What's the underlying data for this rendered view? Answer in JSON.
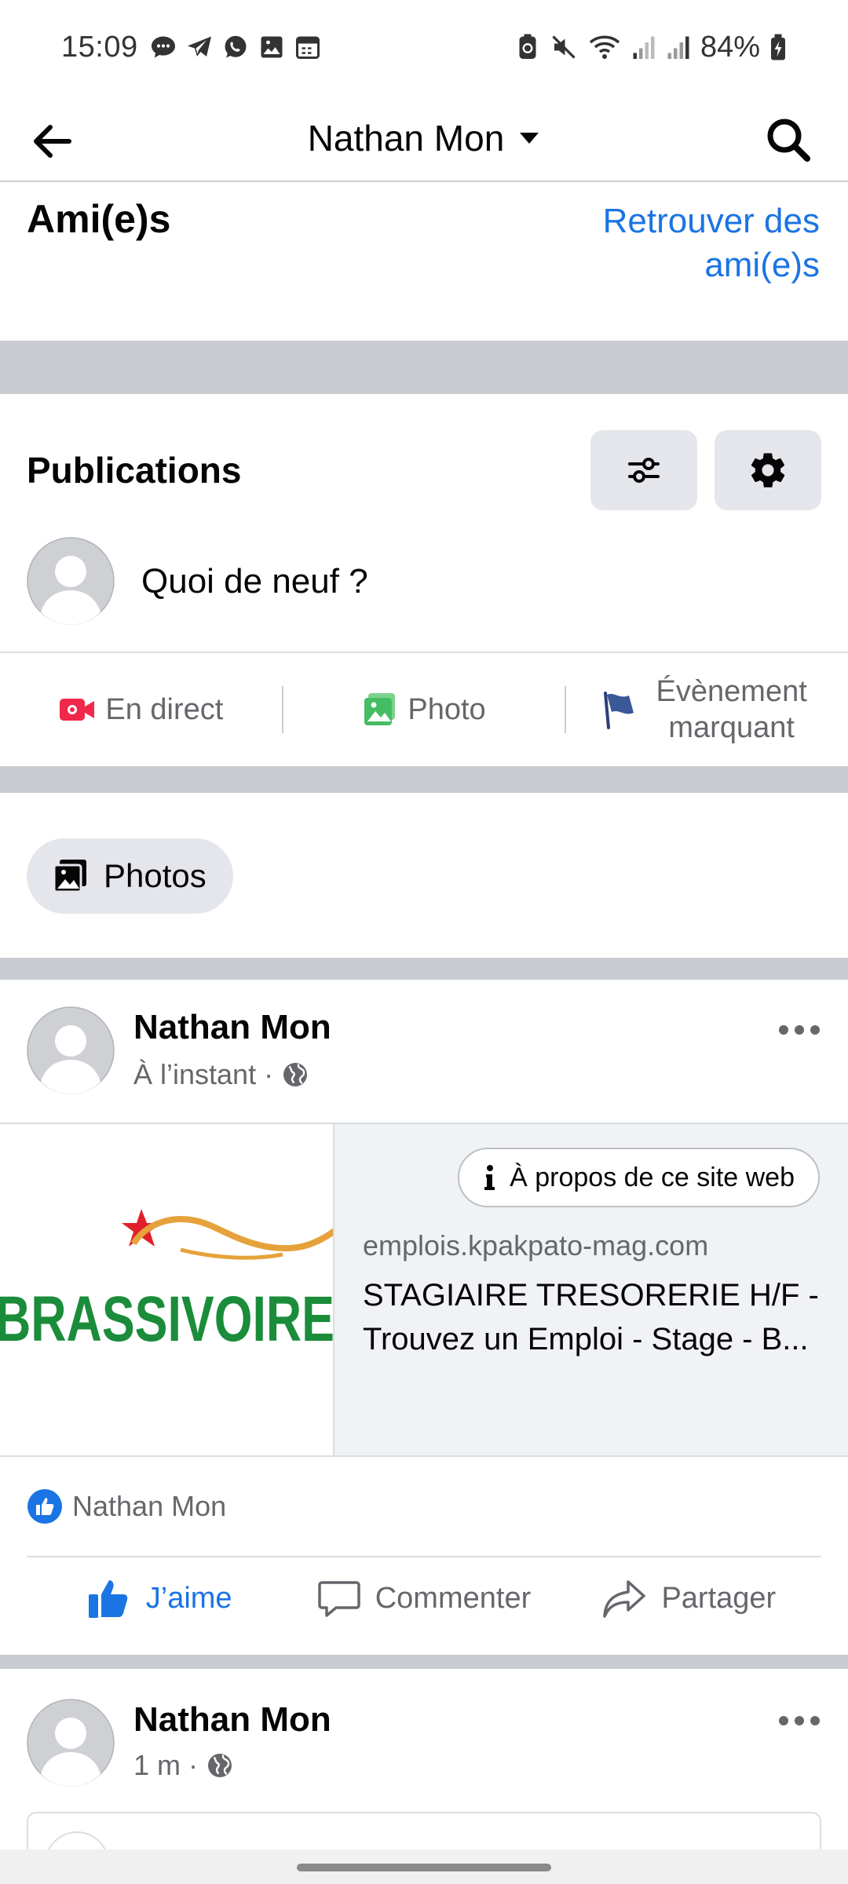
{
  "status_bar": {
    "time": "15:09",
    "battery_text": "84%",
    "notification_icons": [
      "messages-icon",
      "telegram-icon",
      "whatsapp-icon",
      "gallery-icon",
      "calendar-icon"
    ],
    "system_icons": [
      "battery-saver-icon",
      "mute-icon",
      "wifi-icon",
      "signal-icon",
      "signal-icon",
      "battery-charging-icon"
    ]
  },
  "header": {
    "title": "Nathan Mon",
    "back_icon": "back-arrow-icon",
    "dropdown_icon": "caret-down-icon",
    "search_icon": "search-icon"
  },
  "friends": {
    "heading": "Ami(e)s",
    "find_link": "Retrouver des ami(e)s"
  },
  "publications": {
    "heading": "Publications",
    "filter_icon": "filter-icon",
    "settings_icon": "gear-icon",
    "composer_placeholder": "Quoi de neuf ?"
  },
  "composer_actions": [
    {
      "label": "En direct",
      "icon": "live-video-icon"
    },
    {
      "label": "Photo",
      "icon": "photo-icon"
    },
    {
      "label": "Évènement marquant",
      "icon": "flag-icon"
    }
  ],
  "photos_chip": {
    "label": "Photos",
    "icon": "photos-icon"
  },
  "post1": {
    "author": "Nathan Mon",
    "time": "À l’instant",
    "separator": "·",
    "privacy_icon": "globe-icon",
    "more_icon": "more-horizontal-icon",
    "link": {
      "about_label": "À propos de ce site web",
      "about_icon": "info-icon",
      "logo_text": "BRASSIVOIRE",
      "domain": "emplois.kpakpato-mag.com",
      "title": "STAGIAIRE TRESORERIE H/F - Trouvez un Emploi - Stage - B..."
    },
    "reaction_name": "Nathan Mon",
    "actions": {
      "like": "J’aime",
      "comment": "Commenter",
      "share": "Partager"
    }
  },
  "post2": {
    "author": "Nathan Mon",
    "time": "1 m",
    "separator": "·",
    "privacy_icon": "globe-icon",
    "more_icon": "more-horizontal-icon"
  },
  "colors": {
    "accent": "#1b74e4",
    "separator": "#c9ccd1",
    "chip_bg": "#e4e6eb",
    "live_red": "#f02849",
    "photo_green": "#45bd62",
    "flag_blue": "#3b5998",
    "brand_green": "#1a8c3a",
    "logo_red": "#e0202a"
  }
}
